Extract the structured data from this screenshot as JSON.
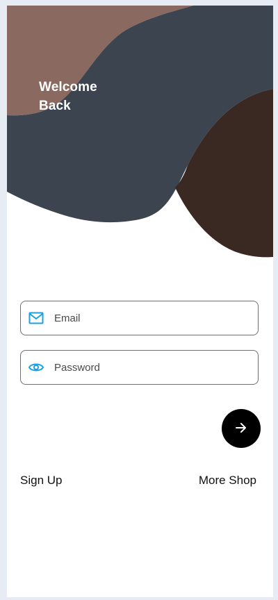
{
  "header": {
    "welcome_line1": "Welcome",
    "welcome_line2": "Back",
    "colors": {
      "blob_brown": "#8a6a60",
      "blob_slate": "#3c4450",
      "blob_dark": "#3a2822"
    }
  },
  "form": {
    "email": {
      "placeholder": "Email",
      "value": "",
      "icon": "mail-icon"
    },
    "password": {
      "placeholder": "Password",
      "value": "",
      "icon": "eye-icon"
    },
    "accent_color": "#1aa0e6",
    "submit": {
      "icon": "arrow-right-icon",
      "color": "#000000"
    }
  },
  "links": {
    "sign_up": "Sign Up",
    "more_shop": "More Shop"
  }
}
